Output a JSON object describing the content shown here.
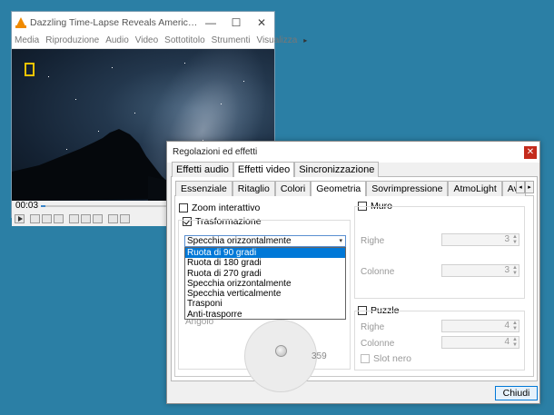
{
  "vlc": {
    "title": "Dazzling Time-Lapse Reveals America's Great Skies | National Geographic",
    "menu": [
      "Media",
      "Riproduzione",
      "Audio",
      "Video",
      "Sottotitolo",
      "Strumenti",
      "Visualizza"
    ],
    "more": "▸",
    "time": "00:03",
    "progress": 0.02
  },
  "dialog": {
    "title": "Regolazioni ed effetti",
    "close_glyph": "✕",
    "tabs": [
      "Effetti audio",
      "Effetti video",
      "Sincronizzazione"
    ],
    "active_tab": 1,
    "subtabs": [
      "Essenziale",
      "Ritaglio",
      "Colori",
      "Geometria",
      "Sovrimpressione",
      "AtmoLight",
      "Avanzato"
    ],
    "active_subtab": 3,
    "subtab_left_arrow": "◂",
    "subtab_right_arrow": "▸",
    "zoom_label": "Zoom interattivo",
    "zoom_checked": false,
    "transform_label": "Trasformazione",
    "transform_checked": true,
    "combo_value": "Specchia orizzontalmente",
    "combo_arrow": "▾",
    "dropdown_items": [
      "Ruota di 90 gradi",
      "Ruota di 180 gradi",
      "Ruota di 270 gradi",
      "Specchia orizzontalmente",
      "Specchia verticalmente",
      "Trasponi",
      "Anti-trasporre"
    ],
    "dropdown_selected": 0,
    "angle_label": "Angolo",
    "angle_value": "359",
    "wall": {
      "label": "Muro",
      "checked": false,
      "rows_label": "Righe",
      "rows_value": "3",
      "cols_label": "Colonne",
      "cols_value": "3"
    },
    "puzzle": {
      "label": "Puzzle",
      "checked": false,
      "rows_label": "Righe",
      "rows_value": "4",
      "cols_label": "Colonne",
      "cols_value": "4",
      "black_slot_label": "Slot nero"
    },
    "close_button": "Chiudi"
  }
}
